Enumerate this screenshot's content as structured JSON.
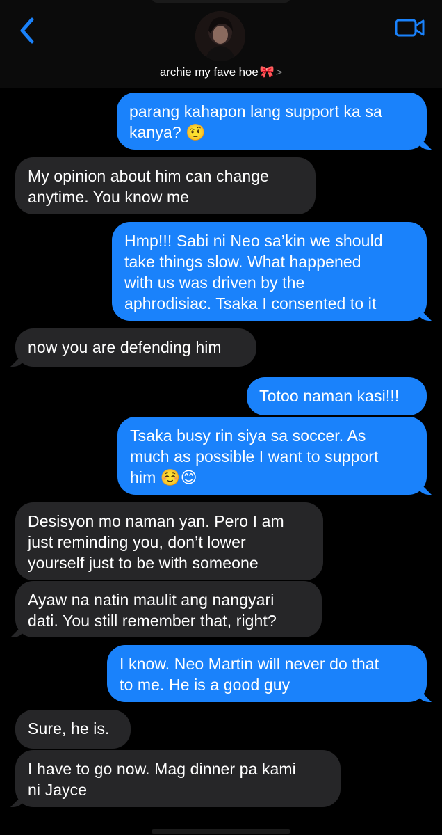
{
  "header": {
    "contact_name": "archie my fave hoe",
    "contact_emoji": "🎀",
    "chevron": ">"
  },
  "messages": [
    {
      "side": "sent",
      "text": "parang kahapon lang support ka sa\nkanya? 🤨"
    },
    {
      "side": "recv",
      "text": "My opinion about him can change\nanytime. You know me"
    },
    {
      "side": "sent",
      "text": "Hmp!!! Sabi ni Neo sa’kin we should\ntake things slow. What happened\nwith us was driven by the\naphrodisiac. Tsaka I consented to it"
    },
    {
      "side": "recv",
      "text": "now you are defending him"
    },
    {
      "side": "sent",
      "text": "Totoo naman kasi!!!"
    },
    {
      "side": "sent",
      "text": "Tsaka busy rin siya sa soccer. As\nmuch as possible I want to support\nhim ☺️😊"
    },
    {
      "side": "recv",
      "text": "Desisyon mo naman yan. Pero I am\njust reminding you, don’t lower\nyourself just to be with someone"
    },
    {
      "side": "recv",
      "text": "Ayaw na natin maulit ang nangyari\ndati. You still remember that, right?"
    },
    {
      "side": "sent",
      "text": "I know. Neo Martin will never do that\nto me. He is a good guy"
    },
    {
      "side": "recv",
      "text": "Sure, he is."
    },
    {
      "side": "recv",
      "text": "I have to go now. Mag dinner pa kami\nni Jayce"
    }
  ],
  "colors": {
    "sent_bubble": "#1a82fb",
    "recv_bubble": "#262628",
    "accent": "#1a82fb",
    "background": "#000000"
  },
  "icons": {
    "back": "chevron-left-icon",
    "video": "video-camera-icon"
  }
}
